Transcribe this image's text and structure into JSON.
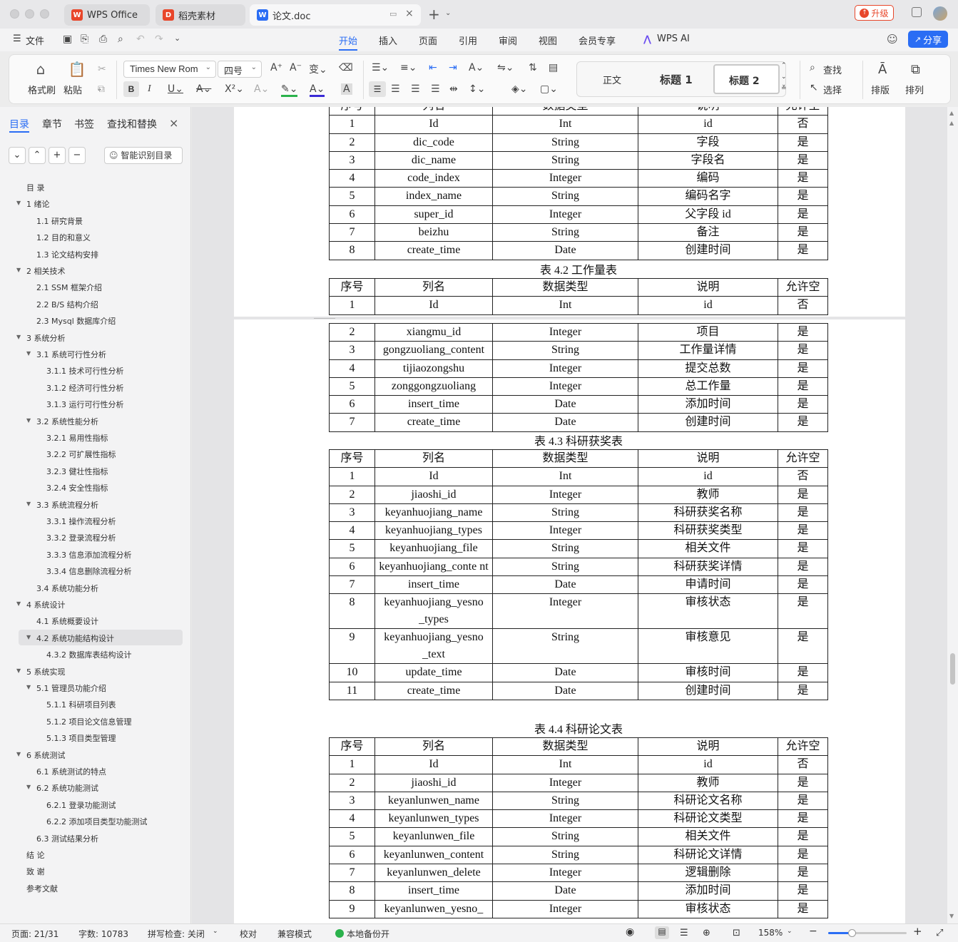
{
  "titlebar": {
    "tabs": [
      {
        "label": "WPS Office",
        "icon": "wps-logo-icon"
      },
      {
        "label": "稻壳素材",
        "icon": "docer-icon"
      },
      {
        "label": "论文.doc",
        "icon": "word-doc-icon"
      }
    ],
    "upgrade_label": "升级"
  },
  "menubar": {
    "file_label": "文件",
    "tabs": [
      "开始",
      "插入",
      "页面",
      "引用",
      "审阅",
      "视图",
      "会员专享"
    ],
    "ai_label": "WPS AI",
    "share_label": "分享"
  },
  "ribbon": {
    "format_painter": "格式刷",
    "paste": "粘贴",
    "font_name": "Times New Rom",
    "font_size": "四号",
    "styles": [
      "正文",
      "标题 1",
      "标题 2"
    ],
    "find": "查找",
    "select": "选择",
    "typeset": "排版",
    "arrange": "排列"
  },
  "sidebar": {
    "tabs": [
      "目录",
      "章节",
      "书签",
      "查找和替换"
    ],
    "smart_toc": "智能识别目录",
    "toc": [
      {
        "text": "目  录",
        "level": 0
      },
      {
        "text": "1  绪论",
        "level": 1
      },
      {
        "text": "1.1  研究背景",
        "level": 2
      },
      {
        "text": "1.2  目的和意义",
        "level": 2
      },
      {
        "text": "1.3  论文结构安排",
        "level": 2
      },
      {
        "text": "2  相关技术",
        "level": 1
      },
      {
        "text": "2.1 SSM 框架介绍",
        "level": 2
      },
      {
        "text": "2.2 B/S 结构介绍",
        "level": 2
      },
      {
        "text": "2.3 Mysql 数据库介绍",
        "level": 2
      },
      {
        "text": "3  系统分析",
        "level": 1
      },
      {
        "text": "3.1  系统可行性分析",
        "level": 2
      },
      {
        "text": "3.1.1  技术可行性分析",
        "level": 3
      },
      {
        "text": "3.1.2  经济可行性分析",
        "level": 3
      },
      {
        "text": "3.1.3  运行可行性分析",
        "level": 3
      },
      {
        "text": "3.2  系统性能分析",
        "level": 2
      },
      {
        "text": "3.2.1  易用性指标",
        "level": 3
      },
      {
        "text": "3.2.2  可扩展性指标",
        "level": 3
      },
      {
        "text": "3.2.3  健壮性指标",
        "level": 3
      },
      {
        "text": "3.2.4  安全性指标",
        "level": 3
      },
      {
        "text": "3.3  系统流程分析",
        "level": 2
      },
      {
        "text": "3.3.1  操作流程分析",
        "level": 3
      },
      {
        "text": "3.3.2  登录流程分析",
        "level": 3
      },
      {
        "text": "3.3.3  信息添加流程分析",
        "level": 3
      },
      {
        "text": "3.3.4  信息删除流程分析",
        "level": 3
      },
      {
        "text": "3.4  系统功能分析",
        "level": 2
      },
      {
        "text": "4  系统设计",
        "level": 1
      },
      {
        "text": "4.1  系统概要设计",
        "level": 2
      },
      {
        "text": "4.2  系统功能结构设计",
        "level": 2
      },
      {
        "text": "4.3.2  数据库表结构设计",
        "level": 3
      },
      {
        "text": "5  系统实现",
        "level": 1
      },
      {
        "text": "5.1  管理员功能介绍",
        "level": 2
      },
      {
        "text": "5.1.1  科研项目列表",
        "level": 3
      },
      {
        "text": "5.1.2  项目论文信息管理",
        "level": 3
      },
      {
        "text": "5.1.3 项目类型管理",
        "level": 3
      },
      {
        "text": "6  系统测试",
        "level": 1
      },
      {
        "text": "6.1  系统测试的特点",
        "level": 2
      },
      {
        "text": "6.2  系统功能测试",
        "level": 2
      },
      {
        "text": "6.2.1  登录功能测试",
        "level": 3
      },
      {
        "text": "6.2.2  添加项目类型功能测试",
        "level": 3
      },
      {
        "text": "6.3  测试结果分析",
        "level": 2
      },
      {
        "text": "结    论",
        "level": 0
      },
      {
        "text": "致    谢",
        "level": 0
      },
      {
        "text": "参考文献",
        "level": 0
      }
    ]
  },
  "document": {
    "header_row": [
      "序号",
      "列名",
      "数据类型",
      "说明",
      "允许空"
    ],
    "table1_rows": [
      [
        "1",
        "Id",
        "Int",
        "id",
        "否"
      ],
      [
        "2",
        "dic_code",
        "String",
        "字段",
        "是"
      ],
      [
        "3",
        "dic_name",
        "String",
        "字段名",
        "是"
      ],
      [
        "4",
        "code_index",
        "Integer",
        "编码",
        "是"
      ],
      [
        "5",
        "index_name",
        "String",
        "编码名字",
        "是"
      ],
      [
        "6",
        "super_id",
        "Integer",
        "父字段 id",
        "是"
      ],
      [
        "7",
        "beizhu",
        "String",
        "备注",
        "是"
      ],
      [
        "8",
        "create_time",
        "Date",
        "创建时间",
        "是"
      ]
    ],
    "caption2": "表 4.2 工作量表",
    "table2a_rows": [
      [
        "1",
        "Id",
        "Int",
        "id",
        "否"
      ]
    ],
    "table2b_rows": [
      [
        "2",
        "xiangmu_id",
        "Integer",
        "项目",
        "是"
      ],
      [
        "3",
        "gongzuoliang_content",
        "String",
        "工作量详情",
        "是"
      ],
      [
        "4",
        "tijiaozongshu",
        "Integer",
        "提交总数",
        "是"
      ],
      [
        "5",
        "zonggongzuoliang",
        "Integer",
        "总工作量",
        "是"
      ],
      [
        "6",
        "insert_time",
        "Date",
        "添加时间",
        "是"
      ],
      [
        "7",
        "create_time",
        "Date",
        "创建时间",
        "是"
      ]
    ],
    "caption3": "表 4.3 科研获奖表",
    "table3_rows": [
      [
        "1",
        "Id",
        "Int",
        "id",
        "否"
      ],
      [
        "2",
        "jiaoshi_id",
        "Integer",
        "教师",
        "是"
      ],
      [
        "3",
        "keyanhuojiang_name",
        "String",
        "科研获奖名称",
        "是"
      ],
      [
        "4",
        "keyanhuojiang_types",
        "Integer",
        "科研获奖类型",
        "是"
      ],
      [
        "5",
        "keyanhuojiang_file",
        "String",
        "相关文件",
        "是"
      ],
      [
        "6",
        "keyanhuojiang_conte nt",
        "String",
        "科研获奖详情",
        "是"
      ],
      [
        "7",
        "insert_time",
        "Date",
        "申请时间",
        "是"
      ],
      [
        "8",
        "keyanhuojiang_yesno _types",
        "Integer",
        "审核状态",
        "是"
      ],
      [
        "9",
        "keyanhuojiang_yesno _text",
        "String",
        "审核意见",
        "是"
      ],
      [
        "10",
        "update_time",
        "Date",
        "审核时间",
        "是"
      ],
      [
        "11",
        "create_time",
        "Date",
        "创建时间",
        "是"
      ]
    ],
    "caption4": "表 4.4 科研论文表",
    "table4_rows": [
      [
        "1",
        "Id",
        "Int",
        "id",
        "否"
      ],
      [
        "2",
        "jiaoshi_id",
        "Integer",
        "教师",
        "是"
      ],
      [
        "3",
        "keyanlunwen_name",
        "String",
        "科研论文名称",
        "是"
      ],
      [
        "4",
        "keyanlunwen_types",
        "Integer",
        "科研论文类型",
        "是"
      ],
      [
        "5",
        "keyanlunwen_file",
        "String",
        "相关文件",
        "是"
      ],
      [
        "6",
        "keyanlunwen_content",
        "String",
        "科研论文详情",
        "是"
      ],
      [
        "7",
        "keyanlunwen_delete",
        "Integer",
        "逻辑删除",
        "是"
      ],
      [
        "8",
        "insert_time",
        "Date",
        "添加时间",
        "是"
      ],
      [
        "9",
        "keyanlunwen_yesno_",
        "Integer",
        "审核状态",
        "是"
      ]
    ]
  },
  "statusbar": {
    "page": "页面: 21/31",
    "words": "字数: 10783",
    "spell": "拼写检查: 关闭",
    "proof": "校对",
    "compat": "兼容模式",
    "backup": "本地备份开",
    "zoom": "158%"
  },
  "colors": {
    "accent": "#2a6df4",
    "upgrade": "#e8462a"
  }
}
